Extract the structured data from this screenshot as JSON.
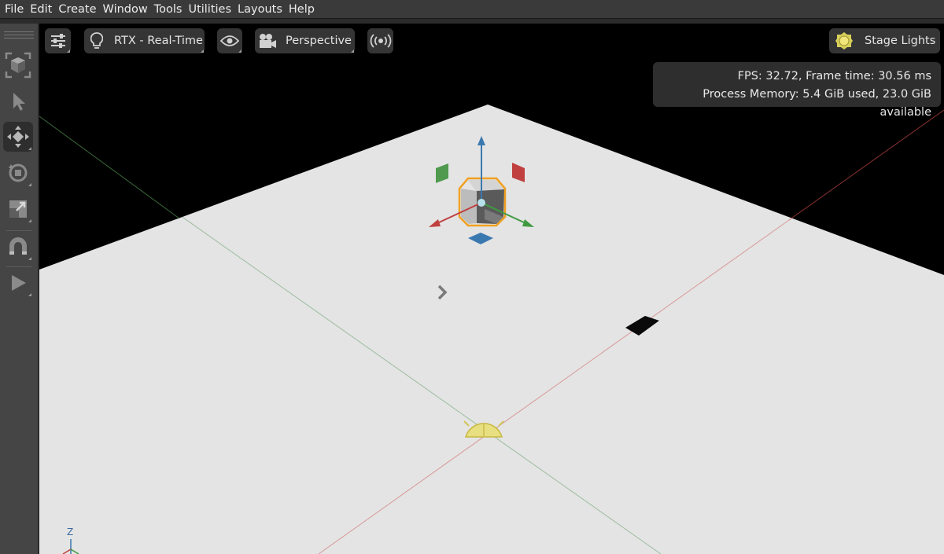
{
  "menubar": {
    "items": [
      "File",
      "Edit",
      "Create",
      "Window",
      "Tools",
      "Utilities",
      "Layouts",
      "Help"
    ]
  },
  "left_toolbar": {
    "tools": [
      {
        "name": "frame-selection-icon",
        "active": false
      },
      {
        "name": "select-arrow-icon",
        "active": false
      },
      {
        "name": "move-icon",
        "active": true
      },
      {
        "name": "rotate-icon",
        "active": false
      },
      {
        "name": "scale-icon",
        "active": false
      },
      {
        "name": "snap-magnet-icon",
        "active": false
      },
      {
        "name": "play-icon",
        "active": false
      }
    ]
  },
  "viewport": {
    "toolbar": {
      "settings_icon": "sliders-icon",
      "renderer_label": "RTX - Real-Time",
      "renderer_icon": "lightbulb-icon",
      "visibility_icon": "eye-icon",
      "camera_label": "Perspective",
      "camera_icon": "camera-icon",
      "live_icon": "broadcast-icon",
      "lights_label": "Stage Lights",
      "lights_icon": "sun-icon"
    },
    "stats": {
      "fps_line": "FPS: 32.72, Frame time: 30.56 ms",
      "memory_line": "Process Memory: 5.4 GiB used, 23.0 GiB available"
    },
    "axis_indicator": {
      "label": "Z"
    },
    "colors": {
      "ground": "#e4e4e4",
      "selection": "#f0a020",
      "axis_x": "#c04040",
      "axis_y": "#3f9a3f",
      "axis_z": "#3a78b0",
      "light_gizmo": "#e8df80"
    }
  }
}
